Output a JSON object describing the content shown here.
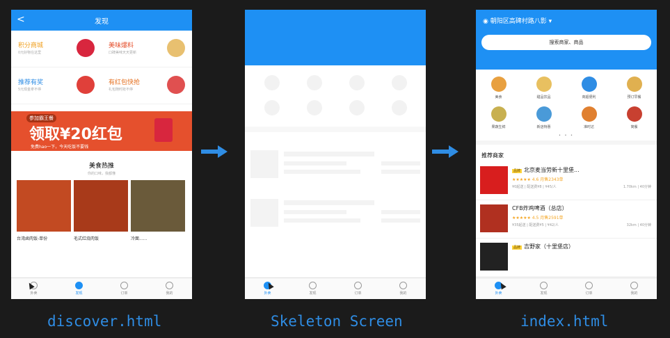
{
  "captions": {
    "left": "discover.html",
    "middle": "Skeleton Screen",
    "right": "index.html"
  },
  "colors": {
    "accent": "#1e90f4",
    "banner": "#e5502d"
  },
  "tabs": [
    "外卖",
    "发现",
    "订单",
    "我的"
  ],
  "discover": {
    "back": "<",
    "title": "发现",
    "cells": [
      {
        "title": "积分商城",
        "sub": "0元好物在这里",
        "color": "#f0a020",
        "img": "#d8263e"
      },
      {
        "title": "美味爆料",
        "sub": "口碑美味天天更新",
        "color": "#e5502d",
        "img": "#e8c070"
      },
      {
        "title": "推荐有奖",
        "sub": "5元现金拿不停",
        "color": "#2f8de4",
        "img": "#e0403a"
      },
      {
        "title": "有红包快抢",
        "sub": "礼包随时抢不停",
        "color": "#e57020",
        "img": "#e05050"
      }
    ],
    "banner": {
      "top": "参加霸王餐",
      "main": "领取¥20红包",
      "bottom": "免费hao一下，今天吃饭不要钱"
    },
    "section_title": "美食热推",
    "section_sub": "你的口味，我都懂",
    "foods": [
      {
        "name": "台湾卤肉饭-单份",
        "color": "#c24a22"
      },
      {
        "name": "毛式红烧肉饭",
        "color": "#a83a1a"
      },
      {
        "name": "冷面......",
        "color": "#6a5a3a"
      }
    ]
  },
  "index": {
    "address": "朝阳区高碑村路八影",
    "search_placeholder": "搜索商家、商品",
    "categories": [
      {
        "label": "美食",
        "color": "#e8a040"
      },
      {
        "label": "甜品饮品",
        "color": "#e8c060"
      },
      {
        "label": "商超便利",
        "color": "#2f8de4"
      },
      {
        "label": "预订早餐",
        "color": "#e0b050"
      },
      {
        "label": "果蔬生鲜",
        "color": "#c8b050"
      },
      {
        "label": "新店特惠",
        "color": "#4a9ad8"
      },
      {
        "label": "准时达",
        "color": "#e08030"
      },
      {
        "label": "简餐",
        "color": "#c84030"
      }
    ],
    "dots": "• • •",
    "section": "推荐商家",
    "shops": [
      {
        "badge": "品牌",
        "name": "北京麦当劳新十里堡...",
        "rating": "★★★★★ 4.6 月售2343单",
        "meta": "¥0起送 | 配送费¥8 | ¥45/人",
        "dist": "1.70km | 40分钟",
        "logo": "#d81e1e"
      },
      {
        "badge": "",
        "name": "CFB炸鸡啤酒（总店）",
        "rating": "★★★★★ 4.5 月售2591单",
        "meta": "¥35起送 | 配送费¥5 | ¥42/人",
        "dist": "32km | 40分钟",
        "logo": "#b03020"
      },
      {
        "badge": "品牌",
        "name": "吉野家（十里堡店）",
        "rating": "",
        "meta": "",
        "dist": "",
        "logo": "#222222"
      }
    ]
  }
}
